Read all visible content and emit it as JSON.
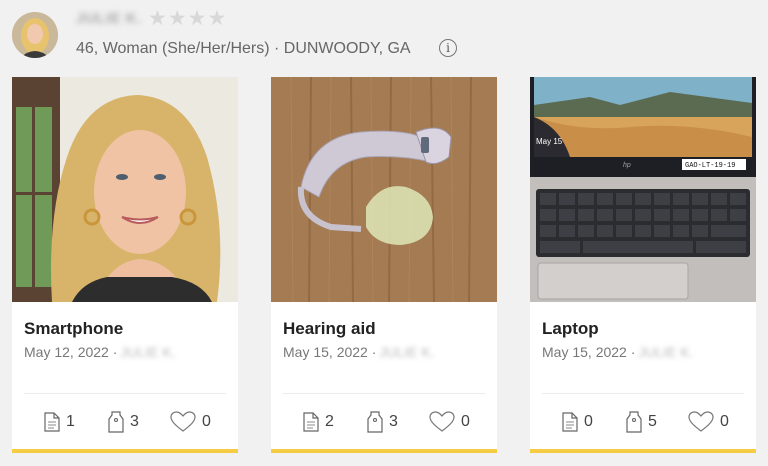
{
  "profile": {
    "name": "JULIE K.",
    "stars": "★★★★",
    "meta": "46, Woman (She/Her/Hers) · DUNWOODY, GA",
    "info_icon": "i"
  },
  "colors": {
    "accent": "#f5cc43",
    "background": "#f1f1f1"
  },
  "cards": [
    {
      "title": "Smartphone",
      "date": "May 12, 2022 ·",
      "author": "JULIE K.",
      "notes": "1",
      "tags": "3",
      "likes": "0"
    },
    {
      "title": "Hearing aid",
      "date": "May 15, 2022 ·",
      "author": "JULIE K.",
      "notes": "2",
      "tags": "3",
      "likes": "0"
    },
    {
      "title": "Laptop",
      "date": "May 15, 2022 ·",
      "author": "JULIE K.",
      "notes": "0",
      "tags": "5",
      "likes": "0",
      "screen_date": "May 15",
      "screen_tag": "GAO-LT-19-19"
    }
  ]
}
